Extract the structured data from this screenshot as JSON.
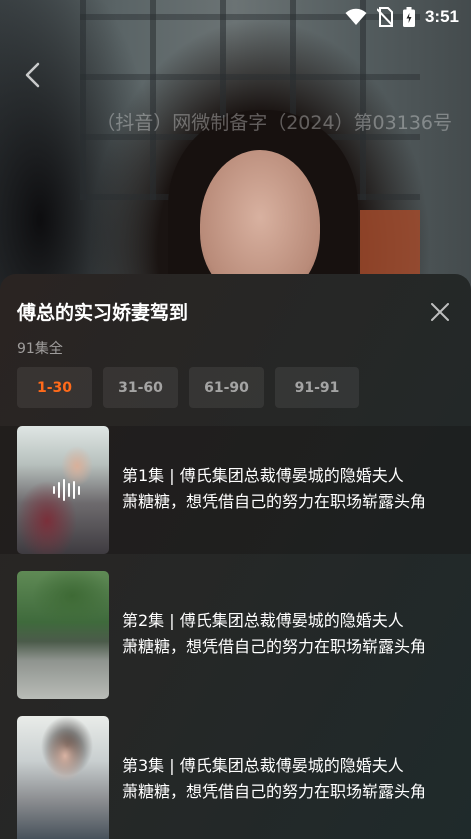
{
  "status_bar": {
    "time": "3:51",
    "icons": [
      "wifi-icon",
      "no-sim-icon",
      "battery-icon"
    ]
  },
  "player": {
    "license_text": "（抖音）网微制备字（2024）第03136号",
    "back_icon": "chevron-left-icon"
  },
  "sheet": {
    "title": "傅总的实习娇妻驾到",
    "episode_count": "91集全",
    "close_icon": "close-icon",
    "ranges": [
      {
        "label": "1-30",
        "active": true
      },
      {
        "label": "31-60",
        "active": false
      },
      {
        "label": "61-90",
        "active": false
      },
      {
        "label": "91-91",
        "active": false
      }
    ],
    "accent_color": "#ff6a1a",
    "episodes": [
      {
        "line1": "第1集 | 傅氏集团总裁傅晏城的隐婚夫人",
        "line2": "萧糖糖，想凭借自己的努力在职场崭露头角",
        "playing": true
      },
      {
        "line1": "第2集 | 傅氏集团总裁傅晏城的隐婚夫人",
        "line2": "萧糖糖，想凭借自己的努力在职场崭露头角",
        "playing": false
      },
      {
        "line1": "第3集 | 傅氏集团总裁傅晏城的隐婚夫人",
        "line2": "萧糖糖，想凭借自己的努力在职场崭露头角",
        "playing": false
      }
    ]
  }
}
